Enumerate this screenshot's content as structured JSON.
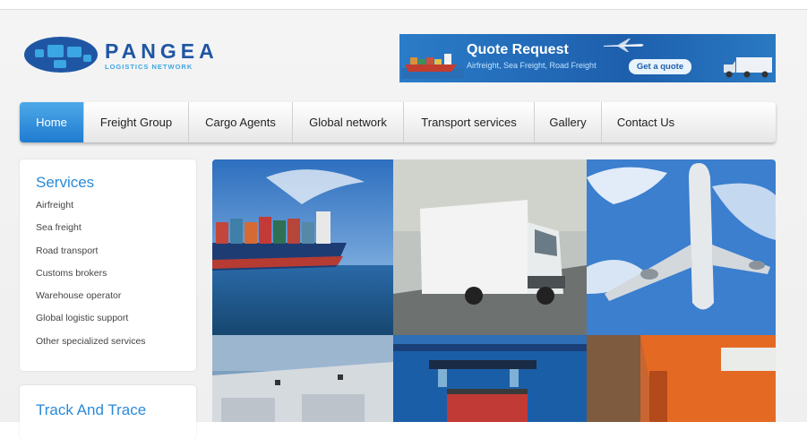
{
  "logo": {
    "name": "PANGEA",
    "subtitle": "LOGISTICS NETWORK"
  },
  "quote_banner": {
    "title": "Quote Request",
    "subtitle": "Airfreight, Sea Freight, Road Freight",
    "button_label": "Get a quote"
  },
  "nav": {
    "items": [
      {
        "label": "Home",
        "active": true
      },
      {
        "label": "Freight Group"
      },
      {
        "label": "Cargo Agents"
      },
      {
        "label": "Global network"
      },
      {
        "label": "Transport services"
      },
      {
        "label": "Gallery"
      },
      {
        "label": "Contact Us"
      }
    ]
  },
  "services": {
    "title": "Services",
    "items": [
      "Airfreight",
      "Sea freight",
      "Road transport",
      "Customs brokers",
      "Warehouse operator",
      "Global logistic support",
      "Other specialized services"
    ]
  },
  "track": {
    "title": "Track And Trace"
  },
  "colors": {
    "brand_blue": "#1f56a3",
    "accent_blue": "#2a8ad8",
    "nav_active": "#2f8ddb"
  }
}
